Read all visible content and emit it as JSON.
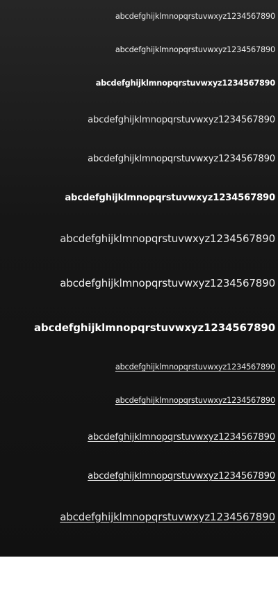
{
  "samples": {
    "text": "abcdefghijklmnopqrstuvwxyz1234567890",
    "lines": [
      {
        "text": "abcdefghijklmnopqrstuvwxyz1234567890"
      },
      {
        "text": "abcdefghijklmnopqrstuvwxyz1234567890"
      },
      {
        "text": "abcdefghijklmnopqrstuvwxyz1234567890"
      },
      {
        "text": "abcdefghijklmnopqrstuvwxyz1234567890"
      },
      {
        "text": "abcdefghijklmnopqrstuvwxyz1234567890"
      },
      {
        "text": "abcdefghijklmnopqrstuvwxyz1234567890"
      },
      {
        "text": "abcdefghijklmnopqrstuvwxyz1234567890"
      },
      {
        "text": "abcdefghijklmnopqrstuvwxyz1234567890"
      },
      {
        "text": "abcdefghijklmnopqrstuvwxyz1234567890"
      },
      {
        "text": "abcdefghijklmnopqrstuvwxyz1234567890"
      },
      {
        "text": "abcdefghijklmnopqrstuvwxyz1234567890"
      },
      {
        "text": "abcdefghijklmnopqrstuvwxyz1234567890"
      },
      {
        "text": "abcdefghijklmnopqrstuvwxyz1234567890"
      },
      {
        "text": "abcdefghijklmnopqrstuvwxyz1234567890"
      }
    ]
  },
  "colors": {
    "panel_top": "#262626",
    "panel_bottom": "#111111",
    "text": "#e6e6e6",
    "page_background": "#ffffff"
  }
}
